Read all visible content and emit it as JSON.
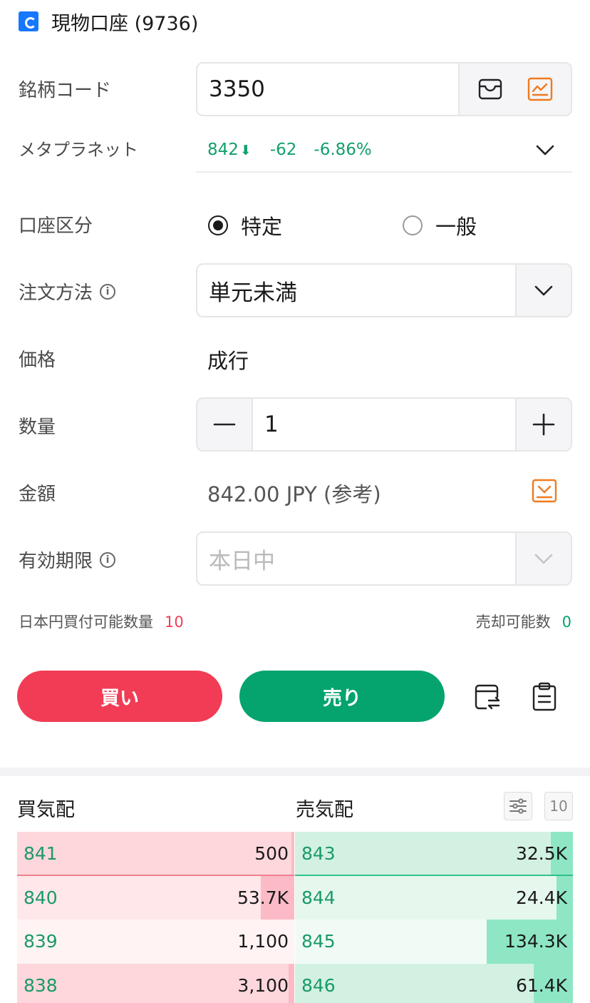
{
  "account": {
    "title": "現物口座 (9736)"
  },
  "form": {
    "code_label": "銘柄コード",
    "code_value": "3350",
    "stock_name": "メタプラネット",
    "quote": {
      "price": "842",
      "price_arrow": "⬇",
      "change": "-62",
      "change_pct": "-6.86%"
    },
    "account_type_label": "口座区分",
    "account_type_options": [
      "特定",
      "一般"
    ],
    "account_type_selected": "特定",
    "order_method_label": "注文方法",
    "order_method_value": "単元未満",
    "price_label": "価格",
    "price_value": "成行",
    "quantity_label": "数量",
    "quantity_value": "1",
    "amount_label": "金額",
    "amount_value": "842.00 JPY (参考)",
    "expiry_label": "有効期限",
    "expiry_placeholder": "本日中",
    "buyable_label": "日本円買付可能数量",
    "buyable_value": "10",
    "sellable_label": "売却可能数",
    "sellable_value": "0"
  },
  "actions": {
    "buy_label": "買い",
    "sell_label": "売り"
  },
  "orderbook": {
    "bid_title": "買気配",
    "ask_title": "売気配",
    "depth_label": "10",
    "rows": [
      {
        "bid_price": "841",
        "bid_qty": "500",
        "ask_price": "843",
        "ask_qty": "32.5K"
      },
      {
        "bid_price": "840",
        "bid_qty": "53.7K",
        "ask_price": "844",
        "ask_qty": "24.4K"
      },
      {
        "bid_price": "839",
        "bid_qty": "1,100",
        "ask_price": "845",
        "ask_qty": "134.3K"
      },
      {
        "bid_price": "838",
        "bid_qty": "3,100",
        "ask_price": "846",
        "ask_qty": "61.4K"
      }
    ],
    "bid_bar_fraction": [
      0.01,
      0.12,
      0.0,
      0.02
    ],
    "ask_bar_fraction": [
      0.08,
      0.06,
      0.31,
      0.14
    ]
  },
  "colors": {
    "buy": "#f23c55",
    "sell": "#05a46f",
    "accent_orange": "#f07a1f",
    "down_green": "#12a06b"
  }
}
